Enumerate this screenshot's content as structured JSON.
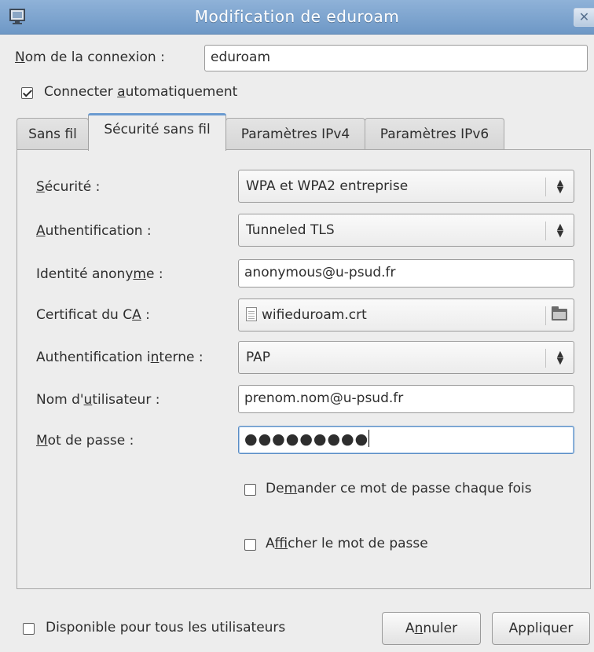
{
  "window": {
    "title": "Modification de eduroam",
    "app_icon": "network-window-icon",
    "close_glyph": "✕"
  },
  "connection": {
    "name_label_pre": "",
    "name_label_mnemonic": "N",
    "name_label_post": "om de la connexion :",
    "name_value": "eduroam",
    "autoconnect_pre": "Connecter ",
    "autoconnect_mnemonic": "a",
    "autoconnect_post": "utomatiquement",
    "autoconnect_checked": true
  },
  "tabs": [
    {
      "label": "Sans fil",
      "active": false
    },
    {
      "label": "Sécurité sans fil",
      "active": true
    },
    {
      "label": "Paramètres IPv4",
      "active": false
    },
    {
      "label": "Paramètres IPv6",
      "active": false
    }
  ],
  "security_form": {
    "security": {
      "label_mnemonic": "S",
      "label_post": "écurité :",
      "value": "WPA et WPA2 entreprise"
    },
    "authentication": {
      "label_mnemonic": "A",
      "label_post": "uthentification :",
      "value": "Tunneled TLS"
    },
    "anonymous_identity": {
      "label_pre": "Identité anony",
      "label_mnemonic": "m",
      "label_post": "e :",
      "value": "anonymous@u-psud.fr"
    },
    "ca_certificate": {
      "label_pre": "Certificat du C",
      "label_mnemonic": "A",
      "label_post": " :",
      "value": "wifieduroam.crt"
    },
    "inner_authentication": {
      "label_pre": "Authentification i",
      "label_mnemonic": "n",
      "label_post": "terne :",
      "value": "PAP"
    },
    "username": {
      "label_pre": "Nom d'",
      "label_mnemonic": "u",
      "label_post": "tilisateur :",
      "value": "prenom.nom@u-psud.fr"
    },
    "password": {
      "label_mnemonic": "M",
      "label_post": "ot de passe :",
      "value": "●●●●●●●●●"
    },
    "ask_password": {
      "label_pre": "De",
      "label_mnemonic": "m",
      "label_post": "ander ce mot de passe chaque fois",
      "checked": false
    },
    "show_password": {
      "label_pre": "A",
      "label_mnemonic": "f",
      "label_post": "ficher le mot de passe",
      "checked": false
    }
  },
  "footer": {
    "all_users_label": "Disponible pour tous les utilisateurs",
    "all_users_checked": false,
    "cancel_pre": "A",
    "cancel_mnemonic": "n",
    "cancel_post": "nuler",
    "apply_label": "Appliquer"
  }
}
